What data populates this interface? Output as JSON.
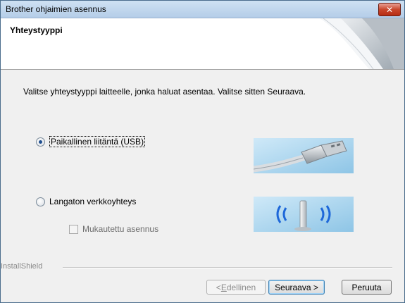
{
  "window": {
    "title": "Brother ohjaimien asennus"
  },
  "header": {
    "title": "Yhteystyyppi"
  },
  "body": {
    "instruction": "Valitse yhteystyyppi laitteelle, jonka haluat asentaa. Valitse sitten Seuraava.",
    "options": [
      {
        "label": "Paikallinen liitäntä (USB)",
        "selected": true
      },
      {
        "label": "Langaton verkkoyhteys",
        "selected": false
      }
    ],
    "custom_install": {
      "label": "Mukautettu asennus",
      "checked": false,
      "enabled": false
    }
  },
  "footer": {
    "installshield": "InstallShield",
    "back_prefix": "< ",
    "back_accel": "E",
    "back_rest": "dellinen",
    "next_label": "Seuraava >",
    "cancel_label": "Peruuta"
  },
  "colors": {
    "titlebar": "#b4cde8",
    "close": "#c9462c",
    "image_bg": "#a9d3ee",
    "wifi_waves": "#1d67d9"
  }
}
